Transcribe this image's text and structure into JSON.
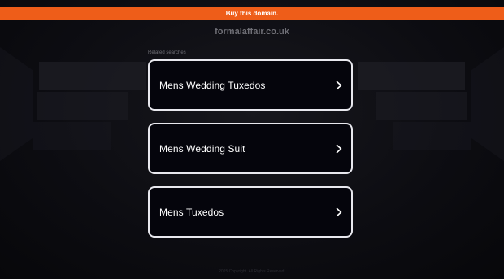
{
  "banner": {
    "label": "Buy this domain."
  },
  "domain": {
    "name": "formalaffair.co.uk"
  },
  "related": {
    "heading": "Related searches",
    "items": [
      {
        "label": "Mens Wedding Tuxedos",
        "icon": "chevron-right-icon"
      },
      {
        "label": "Mens Wedding Suit",
        "icon": "chevron-right-icon"
      },
      {
        "label": "Mens Tuxedos",
        "icon": "chevron-right-icon"
      }
    ]
  },
  "footer": {
    "text": "2025 Copyright. All Rights Reserved."
  },
  "colors": {
    "banner": "#ee5d19",
    "background": "#0b0b10",
    "card_border": "#e8e8ee",
    "muted_text": "#6f6f76"
  }
}
